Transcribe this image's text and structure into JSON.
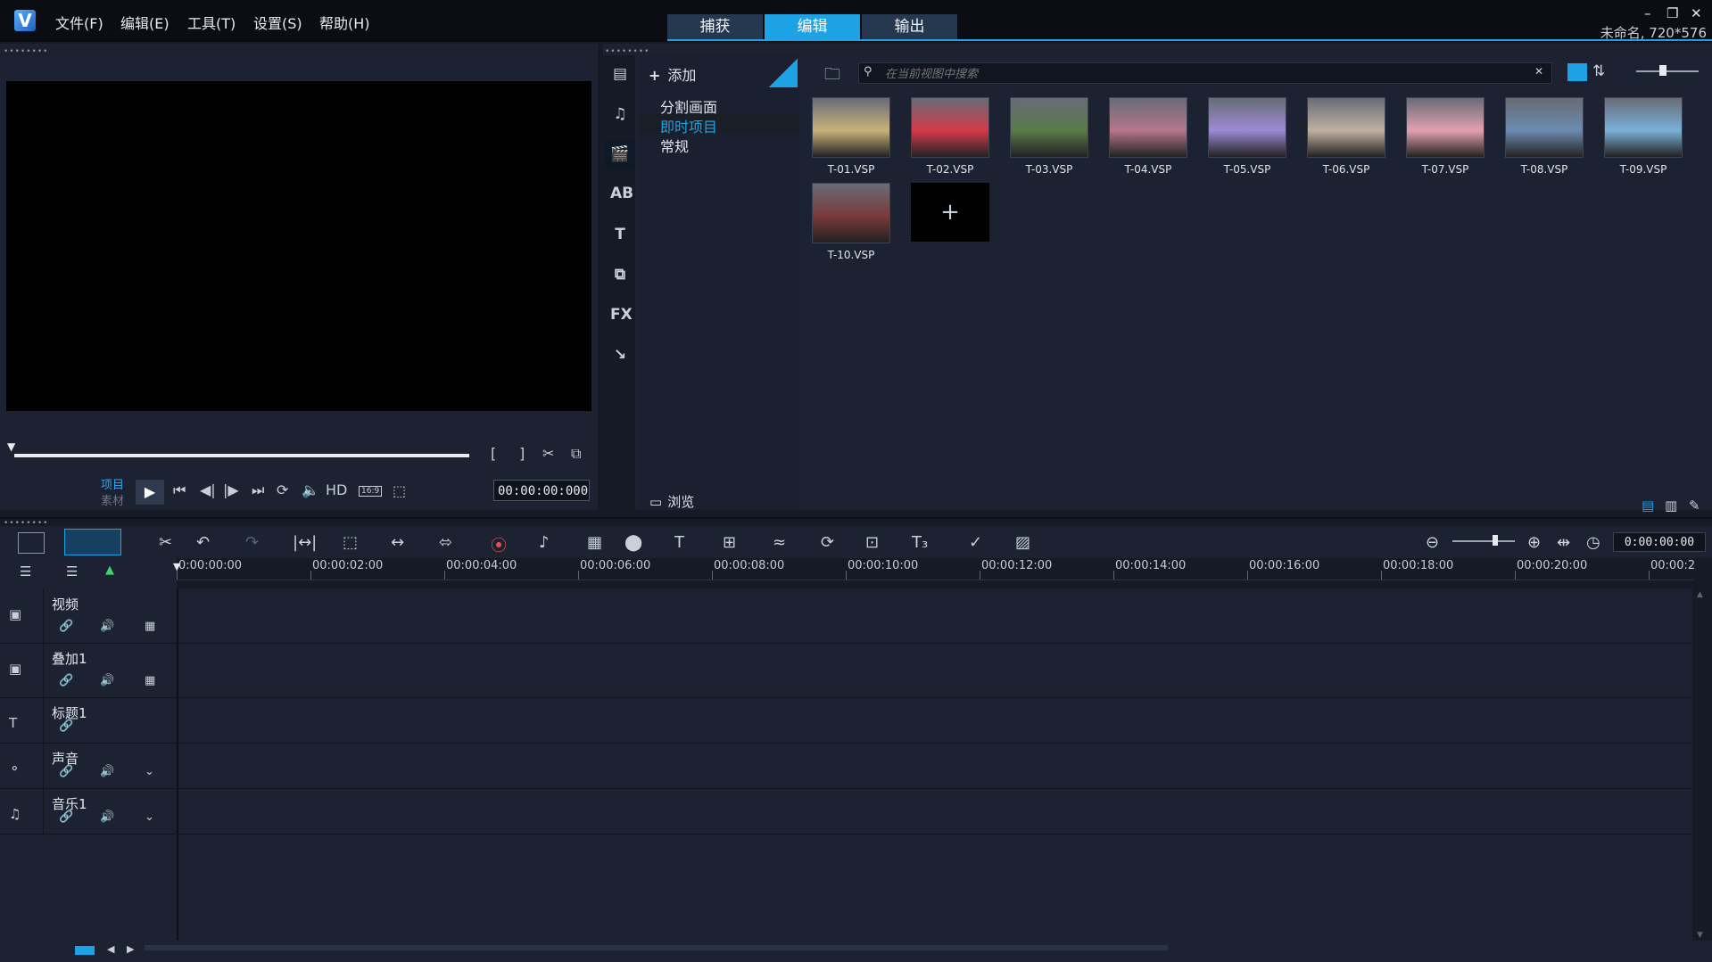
{
  "app": {
    "menu": [
      "文件(F)",
      "编辑(E)",
      "工具(T)",
      "设置(S)",
      "帮助(H)"
    ],
    "tabs": [
      "捕获",
      "编辑",
      "输出"
    ],
    "active_tab": "编辑",
    "project_info": "未命名, 720*576",
    "window_controls": [
      "minimize-icon",
      "restore-icon",
      "close-icon"
    ],
    "accent_color": "#1ea2e6"
  },
  "player": {
    "mode_project": "项目",
    "mode_clip": "素材",
    "hd_label": "HD",
    "aspect_label": "16:9",
    "timecode": "00:00:00:000"
  },
  "library": {
    "add_label": "添加",
    "tree": [
      "分割画面",
      "即时项目",
      "常规"
    ],
    "selected": "即时项目",
    "search_placeholder": "在当前视图中搜索",
    "browse_label": "浏览",
    "side_icons": [
      "media-icon",
      "audio-icon",
      "instant-project-icon",
      "transition-icon",
      "title-icon",
      "graphics-icon",
      "fx-icon",
      "path-icon"
    ],
    "fx_label": "FX",
    "templates": [
      {
        "name": "T-01.VSP",
        "color": "#c8b27a"
      },
      {
        "name": "T-02.VSP",
        "color": "#d43a4a"
      },
      {
        "name": "T-03.VSP",
        "color": "#5b7a4a"
      },
      {
        "name": "T-04.VSP",
        "color": "#b5768a"
      },
      {
        "name": "T-05.VSP",
        "color": "#9c8ad6"
      },
      {
        "name": "T-06.VSP",
        "color": "#c0b0a0"
      },
      {
        "name": "T-07.VSP",
        "color": "#e2a0b0"
      },
      {
        "name": "T-08.VSP",
        "color": "#6c8bb0"
      },
      {
        "name": "T-09.VSP",
        "color": "#7ab0d8"
      },
      {
        "name": "T-10.VSP",
        "color": "#7a3a3a"
      }
    ],
    "add_template_symbol": "+"
  },
  "timeline": {
    "timecode": "0:00:00:00",
    "ruler": [
      "0:00:00:00",
      "00:00:02:00",
      "00:00:04:00",
      "00:00:06:00",
      "00:00:08:00",
      "00:00:10:00",
      "00:00:12:00",
      "00:00:14:00",
      "00:00:16:00",
      "00:00:18:00",
      "00:00:20:00",
      "00:00:2"
    ],
    "tracks": [
      {
        "name": "视频",
        "icon": "video-track-icon"
      },
      {
        "name": "叠加1",
        "icon": "overlay-track-icon"
      },
      {
        "name": "标题1",
        "icon": "title-track-icon"
      },
      {
        "name": "声音",
        "icon": "voice-track-icon"
      },
      {
        "name": "音乐1",
        "icon": "music-track-icon"
      }
    ]
  }
}
